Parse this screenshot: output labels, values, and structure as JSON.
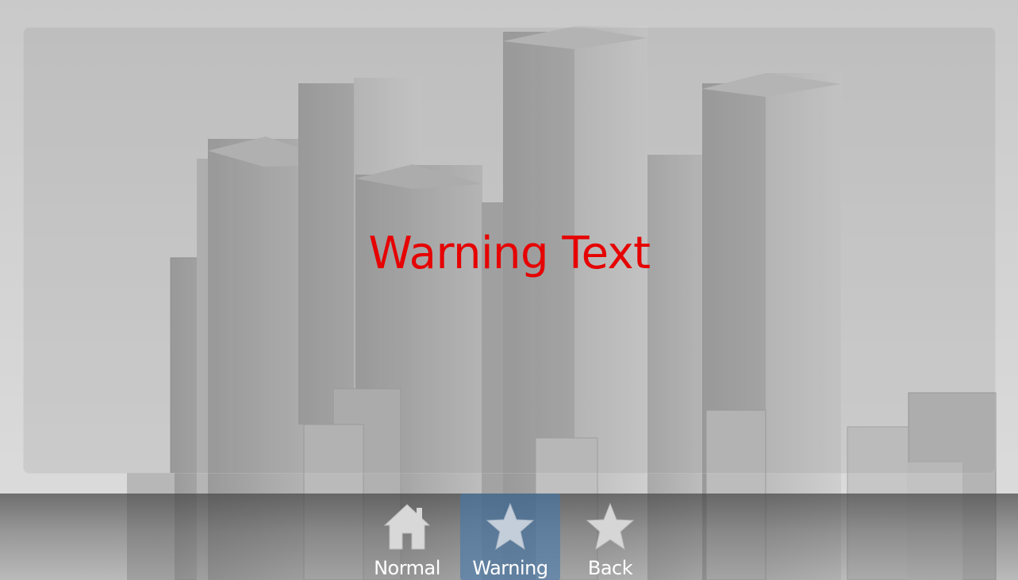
{
  "message": {
    "text": "Warning Text",
    "color": "#e60000"
  },
  "toolbar": {
    "buttons": [
      {
        "label": "Normal",
        "icon": "home-icon",
        "active": false
      },
      {
        "label": "Warning",
        "icon": "star-icon",
        "active": true
      },
      {
        "label": "Back",
        "icon": "star-icon",
        "active": false
      }
    ],
    "active_color": "#4678aa"
  },
  "background": {
    "description_icon": "city-skyline-image"
  }
}
